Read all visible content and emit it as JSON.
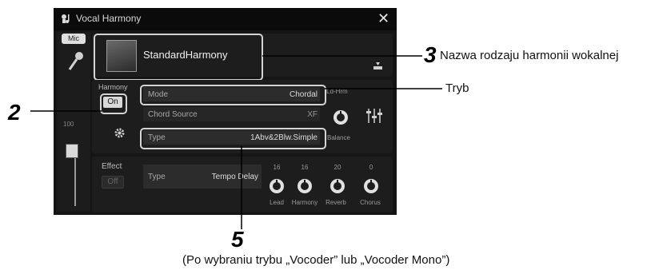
{
  "window": {
    "title": "Vocal Harmony",
    "close_glyph": "✕",
    "title_icon": "vocal-harmony-icon"
  },
  "mic": {
    "tab_label": "Mic",
    "level_value": "100",
    "icon": "microphone-icon"
  },
  "preset": {
    "name": "StandardHarmony",
    "download_icon": "download-icon"
  },
  "harmony": {
    "label": "Harmony",
    "on_label": "On",
    "mode_label": "Mode",
    "mode_value": "Chordal",
    "chord_source_label": "Chord Source",
    "chord_source_value": "XF",
    "type_label": "Type",
    "type_value": "1Abv&2Blw.Simple",
    "lead_harmony_label": "Ld-Hrm",
    "balance_label": "Balance",
    "settings_icon": "gear-icon",
    "mixer_icon": "mixer-icon"
  },
  "effect": {
    "label": "Effect",
    "off_label": "Off",
    "type_label": "Type",
    "type_value": "Tempo Delay",
    "knobs": [
      {
        "label": "Lead",
        "value": "16"
      },
      {
        "label": "Harmony",
        "value": "16"
      },
      {
        "label": "Reverb",
        "value": "20"
      },
      {
        "label": "Chorus",
        "value": "0"
      }
    ]
  },
  "callouts": {
    "c3_number": "3",
    "c3_text": "Nazwa rodzaju harmonii wokalnej",
    "tryb_text": "Tryb",
    "c2_number": "2",
    "c5_number": "5",
    "c5_text": "(Po wybraniu trybu „Vocoder” lub „Vocoder Mono”)"
  }
}
